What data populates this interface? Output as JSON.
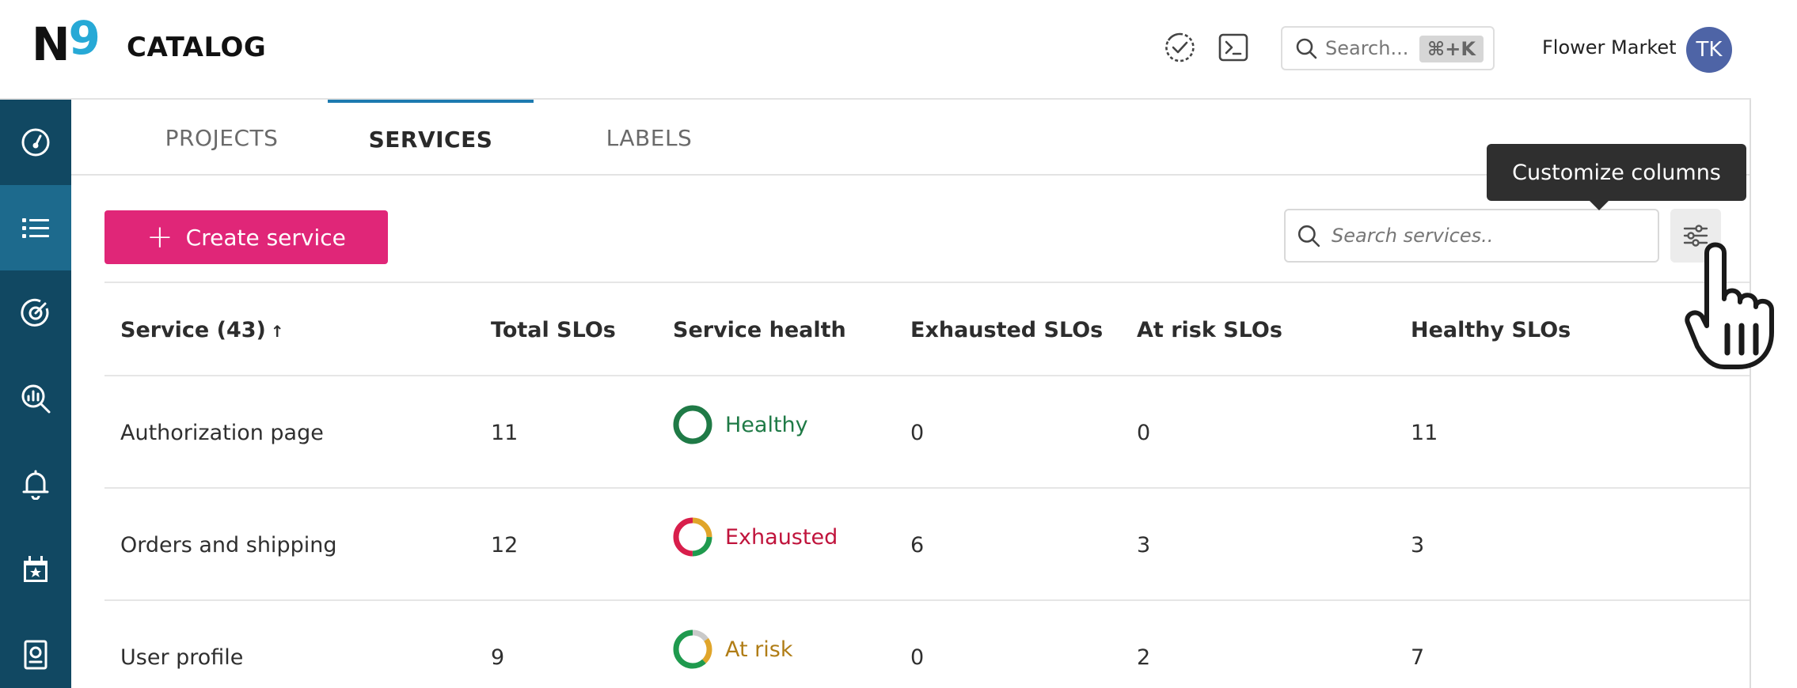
{
  "header": {
    "logo_text_n": "N",
    "logo_text_9": "9",
    "app_title": "CATALOG",
    "search_placeholder": "Search...",
    "search_shortcut": "⌘+K",
    "org_name": "Flower Market",
    "avatar_initials": "TK"
  },
  "sidebar": {
    "items": [
      {
        "icon": "dashboard-gauge-icon",
        "active": false
      },
      {
        "icon": "catalog-list-icon",
        "active": true
      },
      {
        "icon": "slo-target-icon",
        "active": false
      },
      {
        "icon": "analysis-search-icon",
        "active": false
      },
      {
        "icon": "alerts-bell-icon",
        "active": false
      },
      {
        "icon": "calendar-icon",
        "active": false
      },
      {
        "icon": "reports-icon",
        "active": false
      }
    ]
  },
  "tabs": [
    {
      "label": "PROJECTS",
      "active": false
    },
    {
      "label": "SERVICES",
      "active": true
    },
    {
      "label": "LABELS",
      "active": false
    }
  ],
  "toolbar": {
    "create_label": "Create service",
    "search_placeholder": "Search services..",
    "customize_tooltip": "Customize columns"
  },
  "table": {
    "headers": [
      "Service (43)",
      "Total SLOs",
      "Service health",
      "Exhausted SLOs",
      "At risk SLOs",
      "Healthy SLOs"
    ],
    "sort_indicator": "↑",
    "rows": [
      {
        "service": "Authorization page",
        "total": "11",
        "health": "Healthy",
        "exhausted": "0",
        "at_risk": "0",
        "healthy": "11"
      },
      {
        "service": "Orders and shipping",
        "total": "12",
        "health": "Exhausted",
        "exhausted": "6",
        "at_risk": "3",
        "healthy": "3"
      },
      {
        "service": "User profile",
        "total": "9",
        "health": "At risk",
        "exhausted": "0",
        "at_risk": "2",
        "healthy": "7"
      }
    ]
  },
  "colors": {
    "sidebar_bg": "#114862",
    "sidebar_active": "#1d6a8d",
    "primary_pink": "#e02678",
    "tab_accent": "#1d7ab0",
    "healthy_green": "#1f7a46",
    "exhausted_red": "#c0143c",
    "at_risk_amber": "#b07d16"
  }
}
